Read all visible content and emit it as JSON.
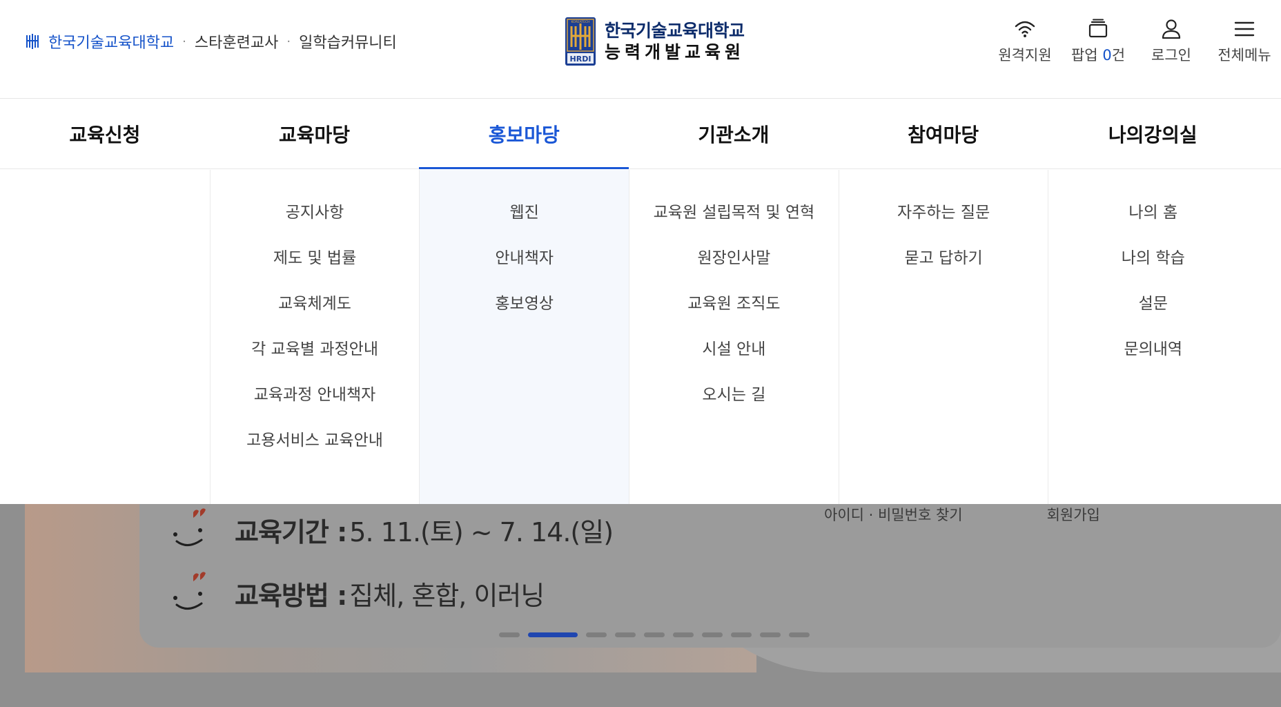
{
  "header": {
    "util_links": [
      "한국기술교육대학교",
      "스타훈련교사",
      "일학습커뮤니티"
    ],
    "logo": {
      "line1": "한국기술교육대학교",
      "line2": "능력개발교육원",
      "emblem_text": "HRDI",
      "emblem_top_text": "KOREATECH"
    },
    "util_icons": [
      {
        "label": "원격지원",
        "icon": "wifi-icon"
      },
      {
        "label_prefix": "팝업 ",
        "count": "0",
        "label_suffix": "건",
        "icon": "popup-icon"
      },
      {
        "label": "로그인",
        "icon": "user-icon"
      },
      {
        "label": "전체메뉴",
        "icon": "hamburger-icon"
      }
    ]
  },
  "nav": {
    "items": [
      "교육신청",
      "교육마당",
      "홍보마당",
      "기관소개",
      "참여마당",
      "나의강의실"
    ],
    "active": "홍보마당"
  },
  "dropdown": {
    "columns": [
      [],
      [
        "공지사항",
        "제도 및 법률",
        "교육체계도",
        "각 교육별 과정안내",
        "교육과정 안내책자",
        "고용서비스 교육안내"
      ],
      [
        "웹진",
        "안내책자",
        "홍보영상"
      ],
      [
        "교육원 설립목적 및 연혁",
        "원장인사말",
        "교육원 조직도",
        "시설 안내",
        "오시는 길"
      ],
      [
        "자주하는 질문",
        "묻고 답하기"
      ],
      [
        "나의 홈",
        "나의 학습",
        "설문",
        "문의내역"
      ]
    ]
  },
  "hero": {
    "rows": [
      {
        "label": "교육기간 : ",
        "value": "5. 11.(토) ~ 7. 14.(일)"
      },
      {
        "label": "교육방법 : ",
        "value": "집체, 혼합, 이러닝"
      }
    ],
    "login_links": {
      "find": "아이디 · 비밀번호 찾기",
      "join": "회원가입"
    },
    "slider": {
      "total": 10,
      "active_index": 1
    }
  },
  "colors": {
    "accent": "#1a57d6",
    "link_blue": "#1452c9",
    "active_col_bg": "#f5f8fd",
    "overlay": "#8f8f8f",
    "slider_active": "#1f46b0"
  }
}
